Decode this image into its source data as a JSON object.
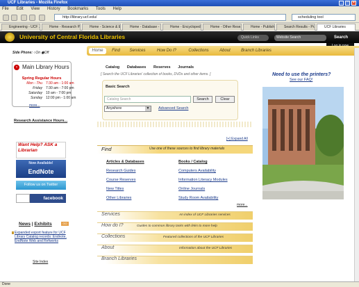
{
  "browser": {
    "window_title": "UCF Libraries - Mozilla Firefox",
    "menu": [
      "File",
      "Edit",
      "View",
      "History",
      "Bookmarks",
      "Tools",
      "Help"
    ],
    "url": "http://library.ucf.edu/",
    "search_value": "scheduling tool",
    "tabs": [
      "Engineering - UCF ...",
      "Home - Research P...",
      "Home - Science & E...",
      "Home - Database - ...",
      "Home - Encycloped...",
      "Home - Other Rese...",
      "Home - Publishing O...",
      "Search Results - Pr...",
      "UCF Libraries"
    ],
    "status": "Done"
  },
  "header": {
    "site_title": "University of Central Florida Libraries",
    "scope_select": "Quick Links",
    "site_search_placeholder": "Website Search",
    "search_button": "Search",
    "login_label": "Log in now",
    "side_phone_label": "Side Phone:",
    "side_phone_on": "On",
    "side_phone_off": "Off"
  },
  "nav": [
    "Home",
    "Find",
    "Services",
    "How Do I?",
    "Collections",
    "About",
    "Branch Libraries"
  ],
  "sidebar": {
    "hours_title": "Main Library Hours",
    "spring_title": "Spring Regular Hours",
    "hours": [
      {
        "day": "Mon - Thu",
        "time": "7:30 am - 1:00 am"
      },
      {
        "day": "Friday",
        "time": "7:30 am - 7:00 pm"
      },
      {
        "day": "Saturday",
        "time": "10 am - 7:00 pm"
      },
      {
        "day": "Sunday",
        "time": "12:00 pm - 1:00 am"
      }
    ],
    "more": "more...",
    "research_hours": "Research Assistance Hours...",
    "ask_text": "Want Help? ASK a Librarian",
    "endnote_top": "Now Available!",
    "endnote_main": "EndNote",
    "twitter": "Follow us on Twitter",
    "facebook": "facebook",
    "news_label": "News",
    "exhibits_label": "Exhibits",
    "news_go": "GO",
    "news_item": "Expanded export feature for UCF Library Catalog records: Endnote, EndNote Web and Refworks",
    "site_index": "Site Index"
  },
  "catalog": {
    "tabs": [
      "Catalog",
      "Databases",
      "Reserves",
      "Journals"
    ],
    "hint": "[ Search the UCF Libraries' collection of books, DVDs and other items. ]",
    "basic_title": "Basic Search",
    "input_placeholder": "Catalog Search",
    "search_btn": "Search",
    "clear_btn": "Clear",
    "scope": "Anywhere",
    "advanced": "Advanced Search"
  },
  "find": {
    "expand_all": "[+] Expand All",
    "title": "Find",
    "subtitle": "Use one of these sources to find library materials",
    "col1_head": "Articles & Databases",
    "col1": [
      "Research Guides",
      "Course Reserves",
      "New Titles",
      "Other Libraries"
    ],
    "col2_head": "Books / Catalog",
    "col2": [
      "Computers Availability",
      "Information Literacy Modules",
      "Online Journals",
      "Study Room Availability"
    ],
    "more": "more..."
  },
  "sections": [
    {
      "title": "Services",
      "subtitle": "An index of UCF Libraries services"
    },
    {
      "title": "How do I?",
      "subtitle": "Guides to common library tasks with links to more help"
    },
    {
      "title": "Collections",
      "subtitle": "Featured collections of the UCF Libraries"
    },
    {
      "title": "About",
      "subtitle": "Information about the UCF Libraries"
    },
    {
      "title": "Branch Libraries",
      "subtitle": ""
    }
  ],
  "right": {
    "printers": "Need to use the printers?",
    "faq": "See our FAQ!"
  },
  "colors": {
    "accent_gold": "#f0c400",
    "nav_gold": "#f5d77b",
    "dark_bar": "#111111",
    "link_blue": "#1a3a8a",
    "hours_red": "#cc0000"
  }
}
